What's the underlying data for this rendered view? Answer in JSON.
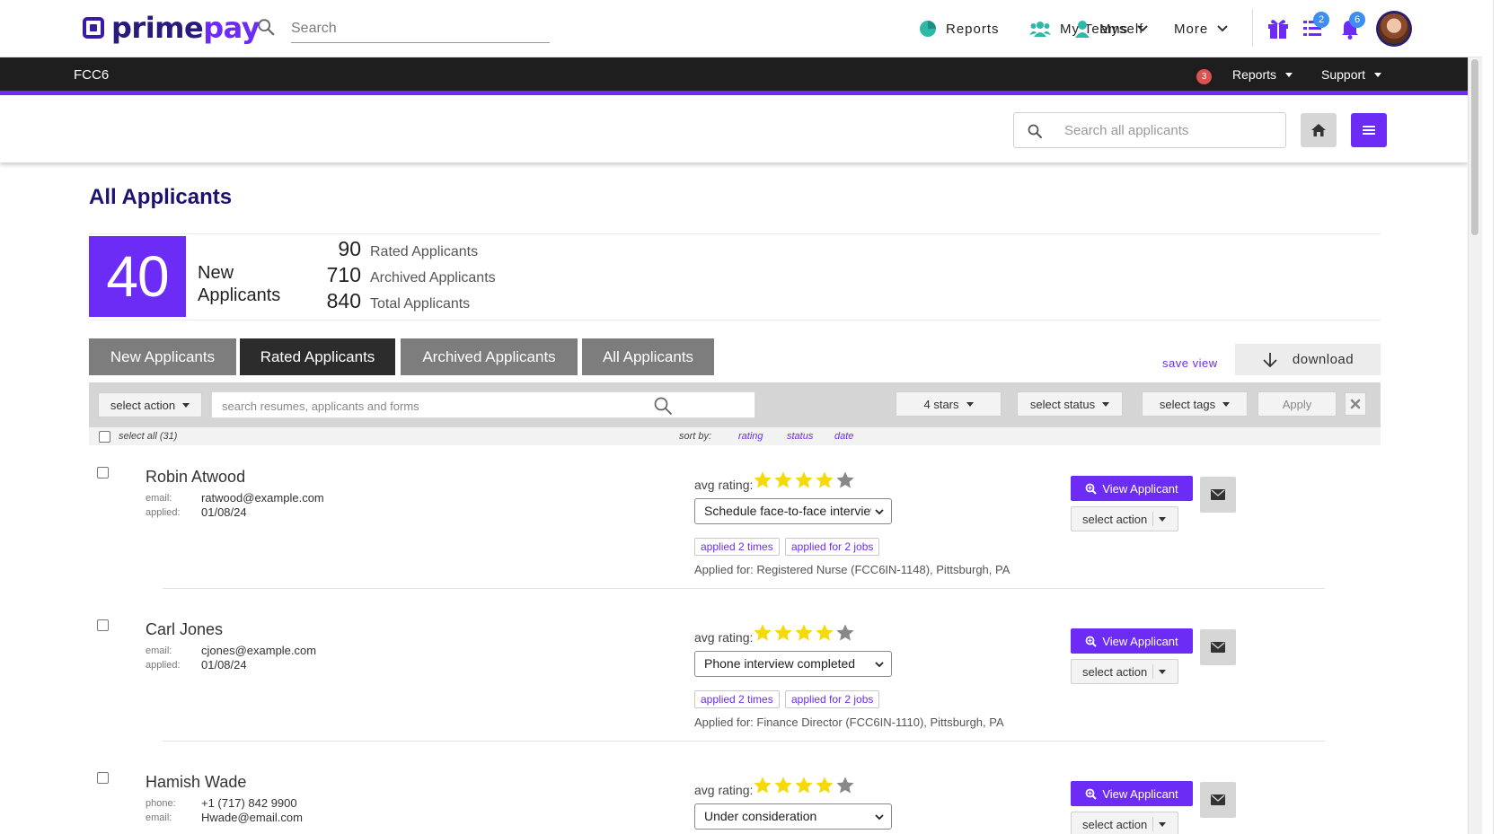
{
  "brand": {
    "name_prime": "prime",
    "name_pay": "pay"
  },
  "topnav": {
    "search_placeholder": "Search",
    "reports": "Reports",
    "my_teams": "My Teams",
    "myself": "Myself",
    "more": "More",
    "tasks_badge": "2",
    "notifications_badge": "6"
  },
  "darkbar": {
    "title": "FCC6",
    "alert_count": "3",
    "reports": "Reports",
    "support": "Support"
  },
  "subbar": {
    "search_placeholder": "Search all applicants"
  },
  "page": {
    "title": "All Applicants"
  },
  "stats": {
    "new_count": "40",
    "new_label": "New Applicants",
    "items": [
      {
        "value": "90",
        "label": "Rated Applicants"
      },
      {
        "value": "710",
        "label": "Archived Applicants"
      },
      {
        "value": "840",
        "label": "Total Applicants"
      }
    ]
  },
  "tabs": [
    {
      "label": "New Applicants"
    },
    {
      "label": "Rated Applicants"
    },
    {
      "label": "Archived Applicants"
    },
    {
      "label": "All Applicants"
    }
  ],
  "actions": {
    "save_view": "save view",
    "download": "download"
  },
  "filters": {
    "select_action": "select action",
    "search_placeholder": "search resumes, applicants and forms",
    "stars": "4 stars",
    "status": "select status",
    "tags": "select tags",
    "apply": "Apply"
  },
  "list": {
    "select_all": "select all (31)",
    "sort_by": "sort by:",
    "sort_rating": "rating",
    "sort_status": "status",
    "sort_date": "date"
  },
  "labels": {
    "avg_rating": "avg rating:",
    "view_applicant": "View Applicant",
    "select_action": "select action"
  },
  "applicants": [
    {
      "name": "Robin Atwood",
      "meta": [
        {
          "k": "email:",
          "v": "ratwood@example.com"
        },
        {
          "k": "applied:",
          "v": "01/08/24"
        }
      ],
      "rating": 4,
      "status": "Schedule face-to-face interview",
      "tags": [
        "applied 2 times",
        "applied for 2 jobs"
      ],
      "applied_for": "Applied for: Registered Nurse (FCC6IN-1148), Pittsburgh, PA"
    },
    {
      "name": "Carl Jones",
      "meta": [
        {
          "k": "email:",
          "v": "cjones@example.com"
        },
        {
          "k": "applied:",
          "v": "01/08/24"
        }
      ],
      "rating": 4,
      "status": "Phone interview completed",
      "tags": [
        "applied 2 times",
        "applied for 2 jobs"
      ],
      "applied_for": "Applied for: Finance Director (FCC6IN-1110), Pittsburgh, PA"
    },
    {
      "name": "Hamish Wade",
      "meta": [
        {
          "k": "phone:",
          "v": "+1 (717) 842 9900"
        },
        {
          "k": "email:",
          "v": "Hwade@email.com"
        }
      ],
      "rating": 4,
      "status": "Under consideration",
      "tags": [],
      "applied_for": ""
    }
  ],
  "colors": {
    "accent": "#6c2cf5",
    "title": "#1c1270",
    "star": "#f5d90a",
    "star_empty": "#888888"
  }
}
